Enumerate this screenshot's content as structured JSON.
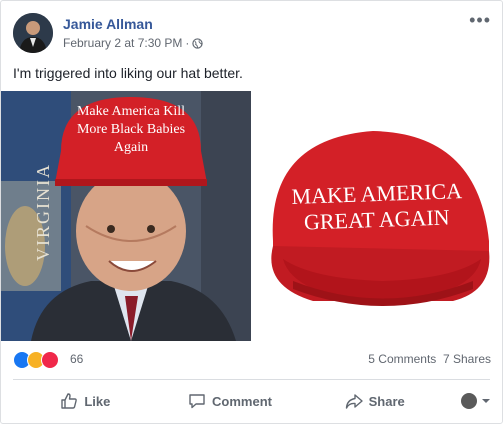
{
  "post": {
    "author": "Jamie Allman",
    "timestamp": "February 2 at 7:30 PM",
    "separator": "·",
    "caption": "I'm triggered into liking our hat better.",
    "more_label": "•••"
  },
  "photos": {
    "left_hat_text": [
      "Make America Kill",
      "More Black Babies",
      "Again"
    ],
    "left_flag_text": "VIRGINIA",
    "right_hat_text": [
      "MAKE AMERICA",
      "GREAT AGAIN"
    ]
  },
  "stats": {
    "reaction_count": "66",
    "comments": "5 Comments",
    "shares": "7 Shares"
  },
  "actions": {
    "like": "Like",
    "comment": "Comment",
    "share": "Share"
  },
  "colors": {
    "link": "#365899",
    "text_secondary": "#616770",
    "hat_red": "#d32027",
    "like_blue": "#1877f2",
    "love_red": "#f0284a",
    "haha_yellow": "#f7b125"
  },
  "icons": [
    "globe-icon",
    "more-icon",
    "like-reaction-icon",
    "haha-reaction-icon",
    "love-reaction-icon",
    "thumbs-up-icon",
    "comment-icon",
    "share-icon",
    "chevron-down-icon"
  ]
}
